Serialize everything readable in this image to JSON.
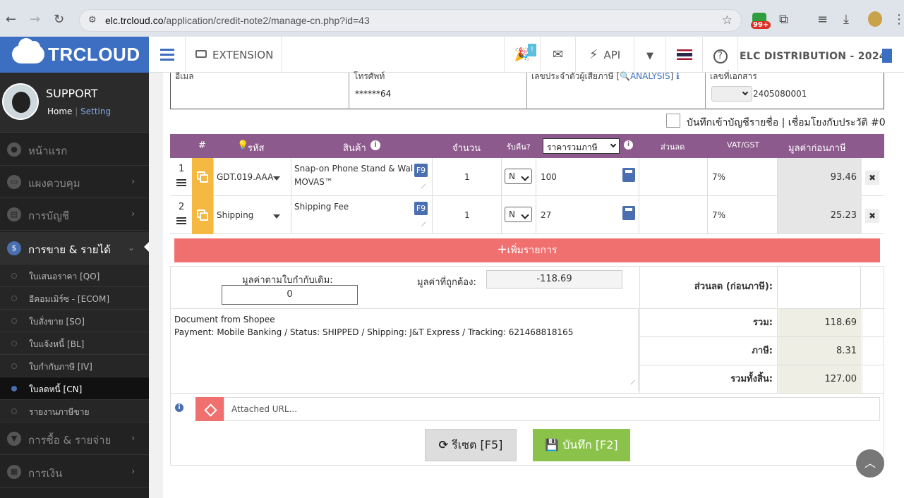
{
  "browser": {
    "url_host": "elc.trcloud.co",
    "url_path": "/application/credit-note2/manage-cn.php?id=43",
    "badge_count": "99+"
  },
  "logo": {
    "text": "TRCLOUD"
  },
  "profile": {
    "name": "SUPPORT",
    "home": "Home",
    "separator": "|",
    "setting": "Setting"
  },
  "sidebar": {
    "items": [
      {
        "label": "หน้าแรก"
      },
      {
        "label": "แผงควบคุม"
      },
      {
        "label": "การบัญชี"
      },
      {
        "label": "การขาย & รายได้"
      },
      {
        "label": "การซื้อ & รายจ่าย"
      },
      {
        "label": "การเงิน"
      }
    ],
    "sub_items": [
      {
        "label": "ใบเสนอราคา [QO]"
      },
      {
        "label": "อีคอมเมิร์ซ - [ECOM]"
      },
      {
        "label": "ใบสั่งขาย [SO]"
      },
      {
        "label": "ใบแจ้งหนี้ [BL]"
      },
      {
        "label": "ใบกำกับภาษี [IV]"
      },
      {
        "label": "ใบลดหนี้ [CN]"
      },
      {
        "label": "รายงานภาษีขาย"
      }
    ]
  },
  "topbar": {
    "extension": "EXTENSION",
    "notif_badge": "!",
    "api": "API",
    "company": "ELC DISTRIBUTION - 2024"
  },
  "info": {
    "email_label": "อีเมล",
    "phone_label": "โทรศัพท์",
    "phone_value": "******64",
    "taxid_label": "เลขประจำตัวผู้เสียภาษี [",
    "analysis_link": "ANALYSIS",
    "taxid_suffix": "]",
    "doc_label": "เลขที่เอกสาร",
    "doc_number": "2405080001"
  },
  "book_checkbox": {
    "label": "บันทึกเข้าบัญชีรายชื่อ | เชื่อมโยงกับประวัติ #0"
  },
  "table": {
    "headers": {
      "num": "#",
      "code": "รหัส",
      "product": "สินค้า",
      "qty": "จำนวน",
      "return": "รับคืน?",
      "price_mode": "ราคารวมภาษี",
      "discount": "ส่วนลด",
      "vat": "VAT/GST",
      "amount": "มูลค่าก่อนภาษี"
    },
    "rows": [
      {
        "num": "1",
        "code": "GDT.019.AAA",
        "product": "Snap-on Phone Stand & Wal MOVAS™",
        "f9": "F9",
        "qty": "1",
        "return": "N",
        "price": "100",
        "vat": "7%",
        "amount": "93.46"
      },
      {
        "num": "2",
        "code": "Shipping",
        "product": "Shipping Fee",
        "f9": "F9",
        "qty": "1",
        "return": "N",
        "price": "27",
        "vat": "7%",
        "amount": "25.23"
      }
    ],
    "add_row": "เพิ่มรายการ"
  },
  "summary": {
    "original_label": "มูลค่าตามใบกำกับเดิม:",
    "original_value": "0",
    "correct_label": "มูลค่าที่ถูกต้อง:",
    "correct_value": "-118.69",
    "discount_label": "ส่วนลด (ก่อนภาษี):",
    "total_label": "รวม:",
    "total_value": "118.69",
    "tax_label": "ภาษี:",
    "tax_value": "8.31",
    "grand_label": "รวมทั้งสิ้น:",
    "grand_value": "127.00"
  },
  "notes": {
    "line1": "Document from Shopee",
    "line2": "Payment: Mobile Banking / Status: SHIPPED / Shipping: J&T Express / Tracking: 621468818165"
  },
  "attach": {
    "placeholder": "Attached URL..."
  },
  "actions": {
    "reset": "รีเซต [F5]",
    "save": "บันทึก [F2]"
  },
  "colors": {
    "accent": "#3c6fc1",
    "table_header": "#8d5a8d",
    "add_button": "#f06f6f",
    "save_button": "#8bc34a"
  }
}
